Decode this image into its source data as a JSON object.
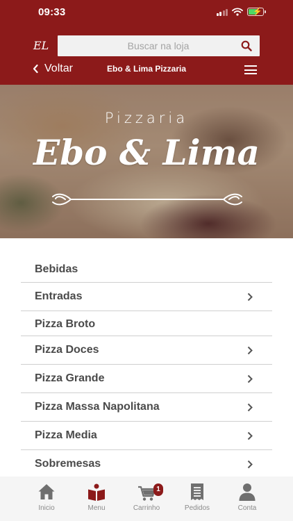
{
  "status_bar": {
    "time": "09:33"
  },
  "header": {
    "logo": "EL",
    "search": {
      "placeholder": "Buscar na loja",
      "value": ""
    },
    "back_label": "Voltar",
    "store_name": "Ebo & Lima Pizzaria"
  },
  "banner": {
    "pre_title": "Pizzaria",
    "name": "Ebo & Lima"
  },
  "categories": [
    {
      "label": "Bebidas",
      "chevron": false
    },
    {
      "label": "Entradas",
      "chevron": true
    },
    {
      "label": "Pizza Broto",
      "chevron": false
    },
    {
      "label": "Pizza Doces",
      "chevron": true
    },
    {
      "label": "Pizza Grande",
      "chevron": true
    },
    {
      "label": "Pizza Massa Napolitana",
      "chevron": true
    },
    {
      "label": "Pizza Media",
      "chevron": true
    },
    {
      "label": "Sobremesas",
      "chevron": true
    }
  ],
  "bottom_nav": {
    "items": [
      {
        "label": "Inicio",
        "icon": "home-icon",
        "active": false
      },
      {
        "label": "Menu",
        "icon": "book-icon",
        "active": true
      },
      {
        "label": "Carrinho",
        "icon": "cart-icon",
        "active": false
      },
      {
        "label": "Pedidos",
        "icon": "receipt-icon",
        "active": false
      },
      {
        "label": "Conta",
        "icon": "user-icon",
        "active": false
      }
    ],
    "cart_count": "1"
  },
  "colors": {
    "brand": "#8c1a1a",
    "icon": "#6f6f6f",
    "label": "#8a8a8a"
  }
}
